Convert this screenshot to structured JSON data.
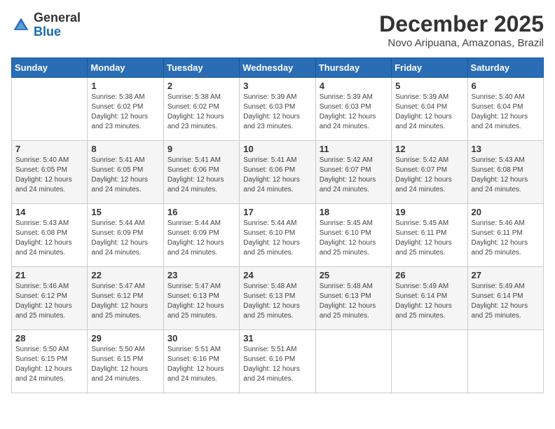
{
  "header": {
    "logo_line1": "General",
    "logo_line2": "Blue",
    "month": "December 2025",
    "location": "Novo Aripuana, Amazonas, Brazil"
  },
  "days_of_week": [
    "Sunday",
    "Monday",
    "Tuesday",
    "Wednesday",
    "Thursday",
    "Friday",
    "Saturday"
  ],
  "weeks": [
    [
      {
        "day": "",
        "info": ""
      },
      {
        "day": "1",
        "info": "Sunrise: 5:38 AM\nSunset: 6:02 PM\nDaylight: 12 hours\nand 23 minutes."
      },
      {
        "day": "2",
        "info": "Sunrise: 5:38 AM\nSunset: 6:02 PM\nDaylight: 12 hours\nand 23 minutes."
      },
      {
        "day": "3",
        "info": "Sunrise: 5:39 AM\nSunset: 6:03 PM\nDaylight: 12 hours\nand 23 minutes."
      },
      {
        "day": "4",
        "info": "Sunrise: 5:39 AM\nSunset: 6:03 PM\nDaylight: 12 hours\nand 24 minutes."
      },
      {
        "day": "5",
        "info": "Sunrise: 5:39 AM\nSunset: 6:04 PM\nDaylight: 12 hours\nand 24 minutes."
      },
      {
        "day": "6",
        "info": "Sunrise: 5:40 AM\nSunset: 6:04 PM\nDaylight: 12 hours\nand 24 minutes."
      }
    ],
    [
      {
        "day": "7",
        "info": "Sunrise: 5:40 AM\nSunset: 6:05 PM\nDaylight: 12 hours\nand 24 minutes."
      },
      {
        "day": "8",
        "info": "Sunrise: 5:41 AM\nSunset: 6:05 PM\nDaylight: 12 hours\nand 24 minutes."
      },
      {
        "day": "9",
        "info": "Sunrise: 5:41 AM\nSunset: 6:06 PM\nDaylight: 12 hours\nand 24 minutes."
      },
      {
        "day": "10",
        "info": "Sunrise: 5:41 AM\nSunset: 6:06 PM\nDaylight: 12 hours\nand 24 minutes."
      },
      {
        "day": "11",
        "info": "Sunrise: 5:42 AM\nSunset: 6:07 PM\nDaylight: 12 hours\nand 24 minutes."
      },
      {
        "day": "12",
        "info": "Sunrise: 5:42 AM\nSunset: 6:07 PM\nDaylight: 12 hours\nand 24 minutes."
      },
      {
        "day": "13",
        "info": "Sunrise: 5:43 AM\nSunset: 6:08 PM\nDaylight: 12 hours\nand 24 minutes."
      }
    ],
    [
      {
        "day": "14",
        "info": "Sunrise: 5:43 AM\nSunset: 6:08 PM\nDaylight: 12 hours\nand 24 minutes."
      },
      {
        "day": "15",
        "info": "Sunrise: 5:44 AM\nSunset: 6:09 PM\nDaylight: 12 hours\nand 24 minutes."
      },
      {
        "day": "16",
        "info": "Sunrise: 5:44 AM\nSunset: 6:09 PM\nDaylight: 12 hours\nand 24 minutes."
      },
      {
        "day": "17",
        "info": "Sunrise: 5:44 AM\nSunset: 6:10 PM\nDaylight: 12 hours\nand 25 minutes."
      },
      {
        "day": "18",
        "info": "Sunrise: 5:45 AM\nSunset: 6:10 PM\nDaylight: 12 hours\nand 25 minutes."
      },
      {
        "day": "19",
        "info": "Sunrise: 5:45 AM\nSunset: 6:11 PM\nDaylight: 12 hours\nand 25 minutes."
      },
      {
        "day": "20",
        "info": "Sunrise: 5:46 AM\nSunset: 6:11 PM\nDaylight: 12 hours\nand 25 minutes."
      }
    ],
    [
      {
        "day": "21",
        "info": "Sunrise: 5:46 AM\nSunset: 6:12 PM\nDaylight: 12 hours\nand 25 minutes."
      },
      {
        "day": "22",
        "info": "Sunrise: 5:47 AM\nSunset: 6:12 PM\nDaylight: 12 hours\nand 25 minutes."
      },
      {
        "day": "23",
        "info": "Sunrise: 5:47 AM\nSunset: 6:13 PM\nDaylight: 12 hours\nand 25 minutes."
      },
      {
        "day": "24",
        "info": "Sunrise: 5:48 AM\nSunset: 6:13 PM\nDaylight: 12 hours\nand 25 minutes."
      },
      {
        "day": "25",
        "info": "Sunrise: 5:48 AM\nSunset: 6:13 PM\nDaylight: 12 hours\nand 25 minutes."
      },
      {
        "day": "26",
        "info": "Sunrise: 5:49 AM\nSunset: 6:14 PM\nDaylight: 12 hours\nand 25 minutes."
      },
      {
        "day": "27",
        "info": "Sunrise: 5:49 AM\nSunset: 6:14 PM\nDaylight: 12 hours\nand 25 minutes."
      }
    ],
    [
      {
        "day": "28",
        "info": "Sunrise: 5:50 AM\nSunset: 6:15 PM\nDaylight: 12 hours\nand 24 minutes."
      },
      {
        "day": "29",
        "info": "Sunrise: 5:50 AM\nSunset: 6:15 PM\nDaylight: 12 hours\nand 24 minutes."
      },
      {
        "day": "30",
        "info": "Sunrise: 5:51 AM\nSunset: 6:16 PM\nDaylight: 12 hours\nand 24 minutes."
      },
      {
        "day": "31",
        "info": "Sunrise: 5:51 AM\nSunset: 6:16 PM\nDaylight: 12 hours\nand 24 minutes."
      },
      {
        "day": "",
        "info": ""
      },
      {
        "day": "",
        "info": ""
      },
      {
        "day": "",
        "info": ""
      }
    ]
  ]
}
